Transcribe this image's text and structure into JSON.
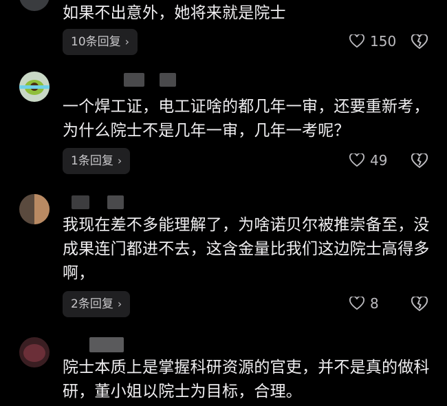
{
  "comments": [
    {
      "text": "如果不出意外，她将来就是院士",
      "reply_label": "10条回复",
      "likes": "150"
    },
    {
      "text": "一个焊工证，电工证啥的都几年一审，还要重新考，为什么院士不是几年一审，几年一考呢？",
      "reply_label": "1条回复",
      "likes": "49"
    },
    {
      "text": "我现在差不多能理解了，为啥诺贝尔被推崇备至，没成果连门都进不去，这含金量比我们这边院士高得多啊，",
      "reply_label": "2条回复",
      "likes": "8"
    },
    {
      "text": "院士本质上是掌握科研资源的官吏，并不是真的做科研，董小姐以院士为目标，合理。"
    }
  ],
  "icons": {
    "like": "heart-outline-icon",
    "dislike": "broken-heart-outline-icon",
    "chevron": "chevron-right-icon"
  },
  "colors": {
    "background": "#000000",
    "text": "#efeef0",
    "pill_bg": "#202022",
    "muted": "#bdbcc0"
  }
}
